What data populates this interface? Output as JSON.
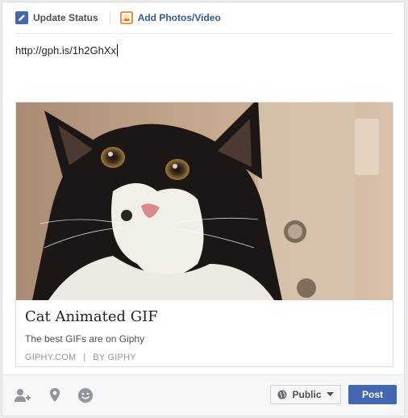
{
  "tabs": {
    "update_status": "Update Status",
    "add_photos": "Add Photos/Video"
  },
  "composer": {
    "text": "http://gph.is/1h2GhXx"
  },
  "link_card": {
    "title": "Cat Animated GIF",
    "description": "The best GIFs are on Giphy",
    "domain": "GIPHY.COM",
    "separator": "|",
    "author": "BY GIPHY",
    "image_icon": "cat-photo"
  },
  "footer": {
    "tag_friends_icon": "tag-people-icon",
    "location_icon": "location-pin-icon",
    "feeling_icon": "smiley-icon",
    "privacy_label": "Public",
    "post_label": "Post"
  },
  "colors": {
    "accent": "#4267b2",
    "link": "#365899",
    "footer_bg": "#f6f7f9"
  }
}
